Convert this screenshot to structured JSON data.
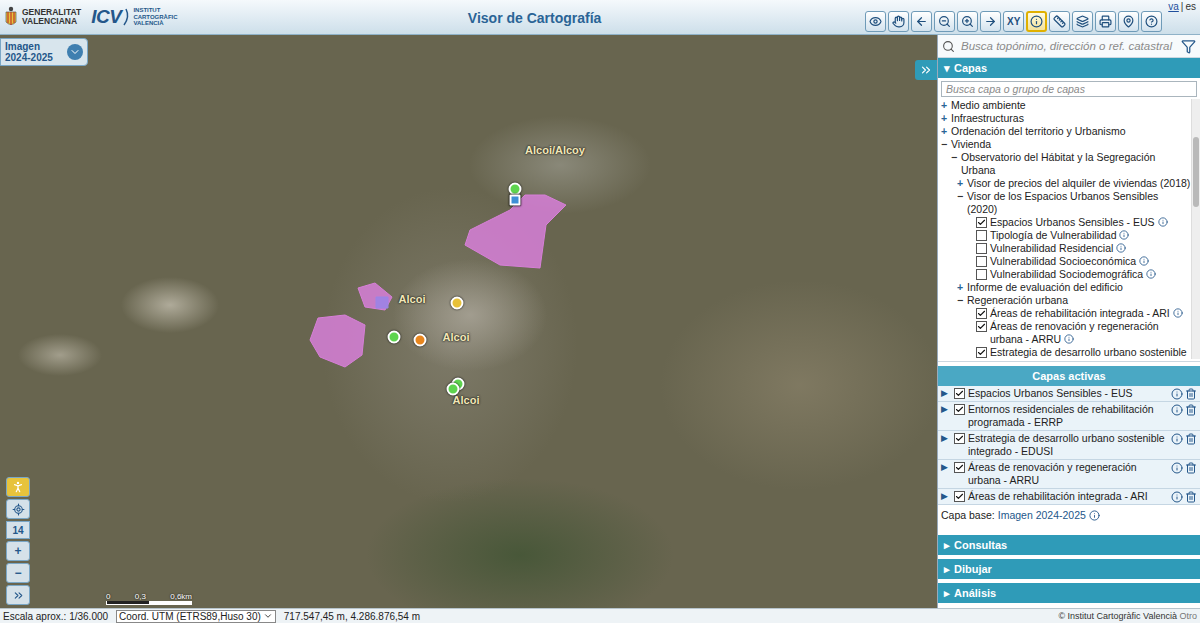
{
  "header": {
    "brand": [
      "GENERALITAT",
      "VALENCIANA"
    ],
    "icv": "ICV",
    "institute": [
      "INSTITUT",
      "CARTOGRÀFIC",
      "VALENCIÀ"
    ],
    "title": "Visor de Cartografía",
    "separator": "|",
    "languages": [
      {
        "label": "va",
        "selected": false
      },
      {
        "label": "es",
        "selected": true
      }
    ]
  },
  "tools": [
    {
      "label": "",
      "selected": false
    },
    {
      "label": "",
      "selected": false
    },
    {
      "label": "",
      "selected": false
    },
    {
      "label": "",
      "selected": false
    },
    {
      "label": "",
      "selected": false
    },
    {
      "label": "",
      "selected": false
    },
    {
      "label": "XY",
      "selected": false
    },
    {
      "label": "",
      "selected": true
    },
    {
      "label": "",
      "selected": false
    },
    {
      "label": "",
      "selected": false
    },
    {
      "label": "",
      "selected": false
    },
    {
      "label": "",
      "selected": false
    },
    {
      "label": "",
      "selected": false
    }
  ],
  "basemap_selector": {
    "lines": [
      "Imagen",
      "2024-2025"
    ]
  },
  "map": {
    "labels": [
      "Alcoi/Alcoy",
      "Alcoi",
      "Alcoi",
      "Alcoi"
    ],
    "markers": [
      {
        "kind": "dot",
        "color": "#5ed44f"
      },
      {
        "kind": "square",
        "color": "#3d8fd6"
      },
      {
        "kind": "dot",
        "color": "#e8c13a"
      },
      {
        "kind": "dot",
        "color": "#5ed44f"
      },
      {
        "kind": "dot",
        "color": "#e8861e"
      },
      {
        "kind": "dot",
        "color": "#5ed44f"
      },
      {
        "kind": "dot",
        "color": "#5ed44f"
      }
    ],
    "areas": [
      {
        "color": "#d77fd8"
      },
      {
        "color": "#d77fd8"
      },
      {
        "color": "#9a84e6"
      },
      {
        "color": "#d77fd8"
      }
    ]
  },
  "map_controls": {
    "zoom": "14",
    "zoom_in": "+",
    "zoom_out": "−"
  },
  "scale_bar": {
    "ticks": [
      "0",
      "0,3",
      "0,6km"
    ]
  },
  "search": {
    "placeholder": "Busca topónimo, dirección o ref. catastral"
  },
  "layers_panel": {
    "toggle": "▾",
    "title": "Capas",
    "expanded": true,
    "search_placeholder": "Busca capa o grupo de capas",
    "tree": [
      {
        "kind": "group",
        "label": "Medio ambiente",
        "depth": 0,
        "expander": "+",
        "expanded": false
      },
      {
        "kind": "group",
        "label": "Infraestructuras",
        "depth": 0,
        "expander": "+",
        "expanded": false
      },
      {
        "kind": "group",
        "label": "Ordenación del territorio y Urbanismo",
        "depth": 0,
        "expander": "+",
        "expanded": false
      },
      {
        "kind": "group",
        "label": "Vivienda",
        "depth": 0,
        "expander": "−",
        "expanded": true
      },
      {
        "kind": "group",
        "label": "Observatorio del Hábitat y la Segregación Urbana",
        "depth": 1,
        "expander": "−",
        "expanded": true
      },
      {
        "kind": "group",
        "label": "Visor de precios del alquiler de viviendas (2018)",
        "depth": 2,
        "expander": "+",
        "expanded": false
      },
      {
        "kind": "group",
        "label": "Visor de los Espacios Urbanos Sensibles (2020)",
        "depth": 2,
        "expander": "−",
        "expanded": true
      },
      {
        "kind": "layer",
        "label": "Espacios Urbanos Sensibles - EUS",
        "depth": 3,
        "checked": true,
        "info": true
      },
      {
        "kind": "layer",
        "label": "Tipología de Vulnerabilidad",
        "depth": 3,
        "checked": false,
        "info": true
      },
      {
        "kind": "layer",
        "label": "Vulnerabilidad Residencial",
        "depth": 3,
        "checked": false,
        "info": true
      },
      {
        "kind": "layer",
        "label": "Vulnerabilidad Socioeconómica",
        "depth": 3,
        "checked": false,
        "info": true
      },
      {
        "kind": "layer",
        "label": "Vulnerabilidad Sociodemográfica",
        "depth": 3,
        "checked": false,
        "info": true
      },
      {
        "kind": "group",
        "label": "Informe de evaluación del edificio",
        "depth": 2,
        "expander": "+",
        "expanded": false
      },
      {
        "kind": "group",
        "label": "Regeneración urbana",
        "depth": 2,
        "expander": "−",
        "expanded": true
      },
      {
        "kind": "layer",
        "label": "Áreas de rehabilitación integrada - ARI",
        "depth": 3,
        "checked": true,
        "info": true
      },
      {
        "kind": "layer",
        "label": "Áreas de renovación y regeneración urbana - ARRU",
        "depth": 3,
        "checked": true,
        "info": true
      },
      {
        "kind": "layer",
        "label": "Estrategia de desarrollo urbano sostenible",
        "depth": 3,
        "checked": true,
        "info": false
      }
    ]
  },
  "active_layers": {
    "title": "Capas activas",
    "items": [
      {
        "toggle": "▶",
        "label": "Espacios Urbanos Sensibles - EUS",
        "checked": true
      },
      {
        "toggle": "▶",
        "label": "Entornos residenciales de rehabilitación programada - ERRP",
        "checked": true
      },
      {
        "toggle": "▶",
        "label": "Estrategia de desarrollo urbano sostenible integrado - EDUSI",
        "checked": true
      },
      {
        "toggle": "▶",
        "label": "Áreas de renovación y regeneración urbana - ARRU",
        "checked": true
      },
      {
        "toggle": "▶",
        "label": "Áreas de rehabilitación integrada - ARI",
        "checked": true
      }
    ],
    "base_label": "Capa base:",
    "base_value": "Imagen 2024-2025"
  },
  "sections": [
    {
      "toggle": "▸",
      "title": "Consultas",
      "expanded": false
    },
    {
      "toggle": "▸",
      "title": "Dibujar",
      "expanded": false
    },
    {
      "toggle": "▸",
      "title": "Análisis",
      "expanded": false
    }
  ],
  "watermark": "ICV",
  "status_bar": {
    "scale": "Escala aprox.: 1/36.000",
    "crs": "Coord. UTM (ETRS89,Huso 30)",
    "coordinates": "717.547,45 m, 4.286.876,54 m",
    "credit": "© Institut Cartogràfic Valencià",
    "more": "Otro"
  }
}
